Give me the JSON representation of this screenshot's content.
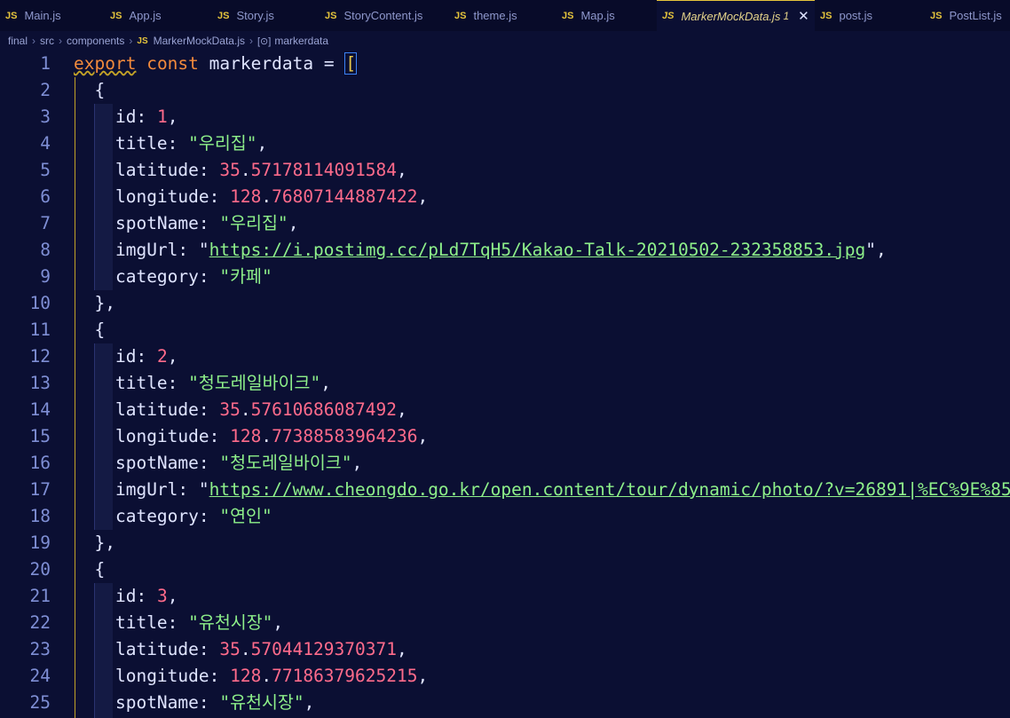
{
  "tabs": [
    {
      "label": "Main.js",
      "width": 118
    },
    {
      "label": "App.js",
      "width": 121
    },
    {
      "label": "Story.js",
      "width": 121
    },
    {
      "label": "StoryContent.js",
      "width": 146
    },
    {
      "label": "theme.js",
      "width": 121
    },
    {
      "label": "Map.js",
      "width": 113
    },
    {
      "label": "MarkerMockData.js",
      "width": 178,
      "active": true,
      "modified": "1"
    },
    {
      "label": "post.js",
      "width": 124
    },
    {
      "label": "PostList.js",
      "width": 96
    }
  ],
  "tab_icon_text": "JS",
  "breadcrumb": {
    "parts": [
      "final",
      "src",
      "components"
    ],
    "file": "MarkerMockData.js",
    "symbol": "markerdata"
  },
  "code": {
    "line1": {
      "kw_export": "export",
      "kw_const": "const",
      "var": "markerdata",
      "eq": "=",
      "bracket": "["
    },
    "open_brace": "{",
    "close_brace_comma": "},",
    "markers": [
      {
        "id": "1",
        "title": "우리집",
        "lat_int": "35",
        "lat_frac": ".57178114091584",
        "lon_int": "128",
        "lon_frac": ".76807144887422",
        "spotName": "우리집",
        "imgUrl": "https://i.postimg.cc/pLd7TqH5/Kakao-Talk-20210502-232358853.jpg",
        "category": "카페"
      },
      {
        "id": "2",
        "title": "청도레일바이크",
        "lat_int": "35",
        "lat_frac": ".57610686087492",
        "lon_int": "128",
        "lon_frac": ".77388583964236",
        "spotName": "청도레일바이크",
        "imgUrl": "https://www.cheongdo.go.kr/open.content/tour/dynamic/photo/?v=26891|%EC%9E%85%EC%84",
        "category": "연인"
      },
      {
        "id": "3",
        "title": "유천시장",
        "lat_int": "35",
        "lat_frac": ".57044129370371",
        "lon_int": "128",
        "lon_frac": ".77186379625215",
        "spotName": "유천시장"
      }
    ]
  },
  "keys": {
    "id": "id",
    "title": "title",
    "latitude": "latitude",
    "longitude": "longitude",
    "spotName": "spotName",
    "imgUrl": "imgUrl",
    "category": "category"
  },
  "tab_close_glyph": "✕"
}
